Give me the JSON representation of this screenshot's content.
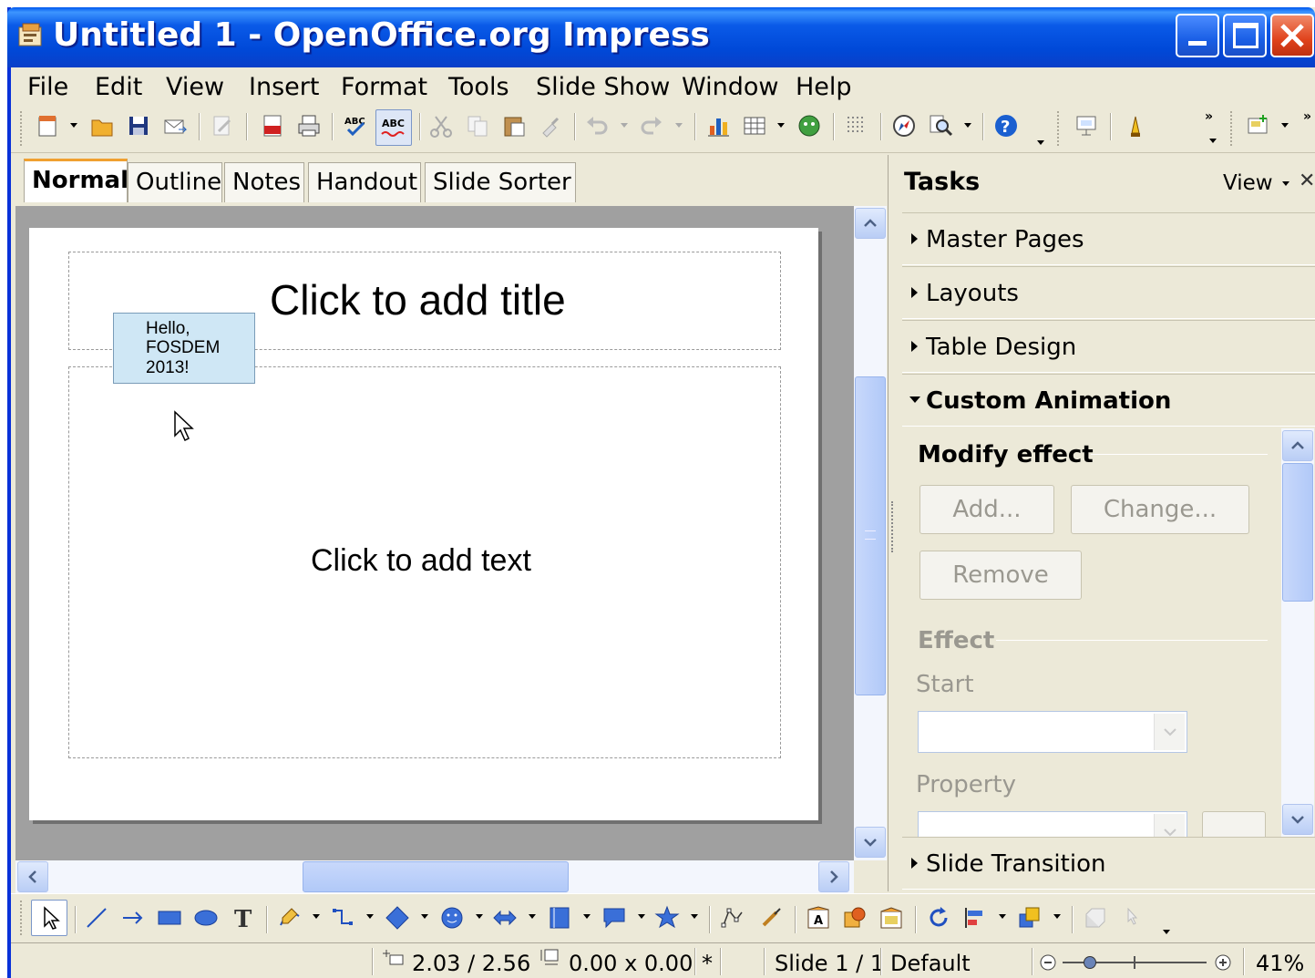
{
  "window": {
    "title": "Untitled 1 - OpenOffice.org Impress",
    "icon": "impress-app-icon"
  },
  "menu": {
    "file": "File",
    "edit": "Edit",
    "view": "View",
    "insert": "Insert",
    "format": "Format",
    "tools": "Tools",
    "slide_show": "Slide Show",
    "window": "Window",
    "help": "Help"
  },
  "view_tabs": {
    "normal": "Normal",
    "outline": "Outline",
    "notes": "Notes",
    "handout": "Handout",
    "slide_sorter": "Slide Sorter"
  },
  "slide": {
    "title_placeholder": "Click to add title",
    "text_placeholder": "Click to add text",
    "textbox_lines": [
      "Hello,",
      "FOSDEM",
      "2013!"
    ]
  },
  "task_pane": {
    "title": "Tasks",
    "view_menu": "View",
    "sections": {
      "master_pages": "Master Pages",
      "layouts": "Layouts",
      "table_design": "Table Design",
      "custom_animation": "Custom Animation",
      "slide_transition": "Slide Transition"
    },
    "custom_animation": {
      "modify_effect": "Modify effect",
      "add_button": "Add...",
      "change_button": "Change...",
      "remove_button": "Remove",
      "effect_group": "Effect",
      "start_label": "Start",
      "start_value": "",
      "property_label": "Property",
      "property_value": ""
    }
  },
  "status": {
    "position": "2.03 / 2.56",
    "size": "0.00 x 0.00",
    "modified": "*",
    "slide": "Slide 1 / 1",
    "layout": "Default",
    "zoom": "41%"
  },
  "colors": {
    "titlebar": "#0a5ae8",
    "chrome": "#ece9d8",
    "textbox_fill": "#cfe7f5",
    "scrollbar": "#b9cdf5"
  }
}
